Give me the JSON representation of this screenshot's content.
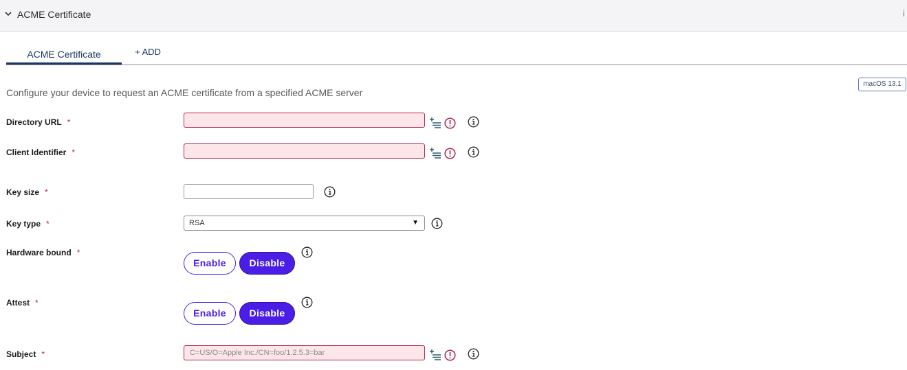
{
  "header": {
    "title": "ACME Certificate"
  },
  "tabs": {
    "active": "ACME Certificate",
    "add": "+ ADD"
  },
  "os_badge": "macOS 13.1",
  "description": "Configure your device to request an ACME certificate from a specified ACME server",
  "required_mark": "*",
  "fields": {
    "directory_url": {
      "label": "Directory URL",
      "value": "",
      "placeholder": ""
    },
    "client_identifier": {
      "label": "Client Identifier",
      "value": "",
      "placeholder": ""
    },
    "key_size": {
      "label": "Key size",
      "value": "",
      "placeholder": ""
    },
    "key_type": {
      "label": "Key type",
      "selected": "RSA"
    },
    "hardware_bound": {
      "label": "Hardware bound",
      "enable_label": "Enable",
      "disable_label": "Disable"
    },
    "attest": {
      "label": "Attest",
      "enable_label": "Enable",
      "disable_label": "Disable"
    },
    "subject": {
      "label": "Subject",
      "value": "",
      "placeholder": "C=US/O=Apple Inc./CN=foo/1.2.5.3=bar"
    }
  },
  "colors": {
    "accent": "#4a1ee6",
    "error": "#b0234a",
    "error_bg": "#fde6ea",
    "nav": "#1c3766"
  }
}
